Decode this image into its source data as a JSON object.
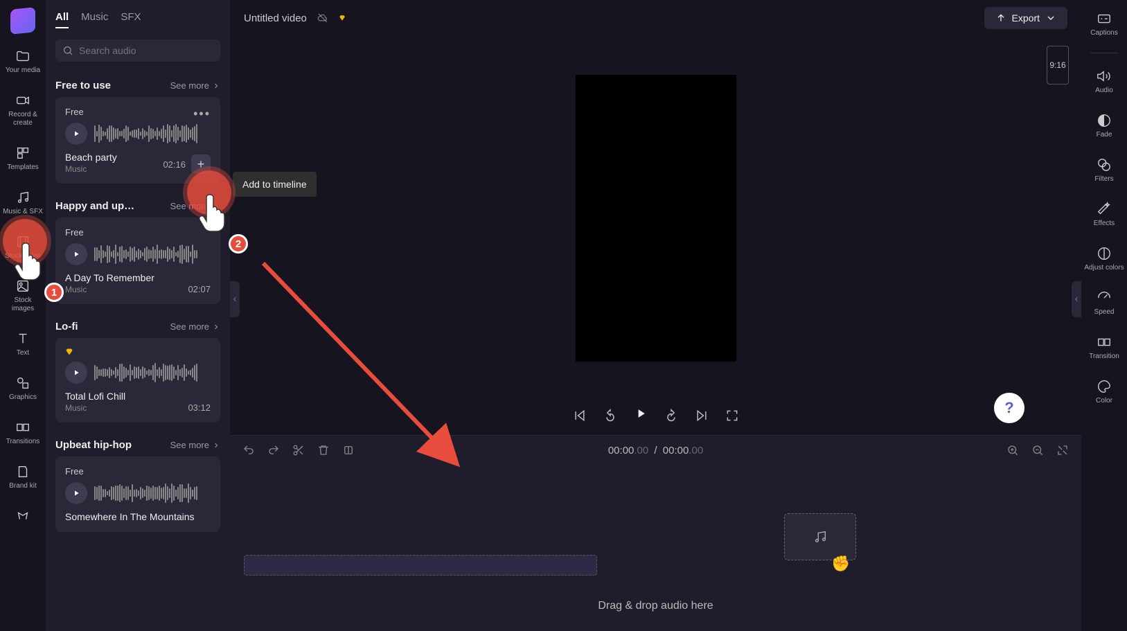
{
  "left_rail": {
    "items": [
      {
        "label": "Your media"
      },
      {
        "label": "Record & create"
      },
      {
        "label": "Templates"
      },
      {
        "label": "Music & SFX"
      },
      {
        "label": "Stock video"
      },
      {
        "label": "Stock images"
      },
      {
        "label": "Text"
      },
      {
        "label": "Graphics"
      },
      {
        "label": "Transitions"
      },
      {
        "label": "Brand kit"
      }
    ]
  },
  "audio_panel": {
    "tabs": {
      "all": "All",
      "music": "Music",
      "sfx": "SFX"
    },
    "search_placeholder": "Search audio",
    "sections": [
      {
        "title": "Free to use",
        "see_more": "See more",
        "track": {
          "tag": "Free",
          "title": "Beach party",
          "sub": "Music",
          "duration": "02:16"
        }
      },
      {
        "title": "Happy and up…",
        "see_more": "See more",
        "track": {
          "tag": "Free",
          "title": "A Day To Remember",
          "sub": "Music",
          "duration": "02:07"
        }
      },
      {
        "title": "Lo-fi",
        "see_more": "See more",
        "track": {
          "tag": "",
          "title": "Total Lofi Chill",
          "sub": "Music",
          "duration": "03:12"
        }
      },
      {
        "title": "Upbeat hip-hop",
        "see_more": "See more",
        "track": {
          "tag": "Free",
          "title": "Somewhere In The Mountains",
          "sub": "",
          "duration": ""
        }
      }
    ]
  },
  "top_bar": {
    "title": "Untitled video",
    "export": "Export"
  },
  "preview": {
    "aspect": "9:16"
  },
  "timeline": {
    "current": "00:00",
    "current_ms": ".00",
    "sep": "/",
    "total": "00:00",
    "total_ms": ".00",
    "drop_text": "Drag & drop audio here"
  },
  "right_rail": {
    "items": [
      {
        "label": "Captions"
      },
      {
        "label": "Audio"
      },
      {
        "label": "Fade"
      },
      {
        "label": "Filters"
      },
      {
        "label": "Effects"
      },
      {
        "label": "Adjust colors"
      },
      {
        "label": "Speed"
      },
      {
        "label": "Transition"
      },
      {
        "label": "Color"
      }
    ]
  },
  "anno": {
    "tooltip": "Add to timeline",
    "badge1": "1",
    "badge2": "2"
  }
}
